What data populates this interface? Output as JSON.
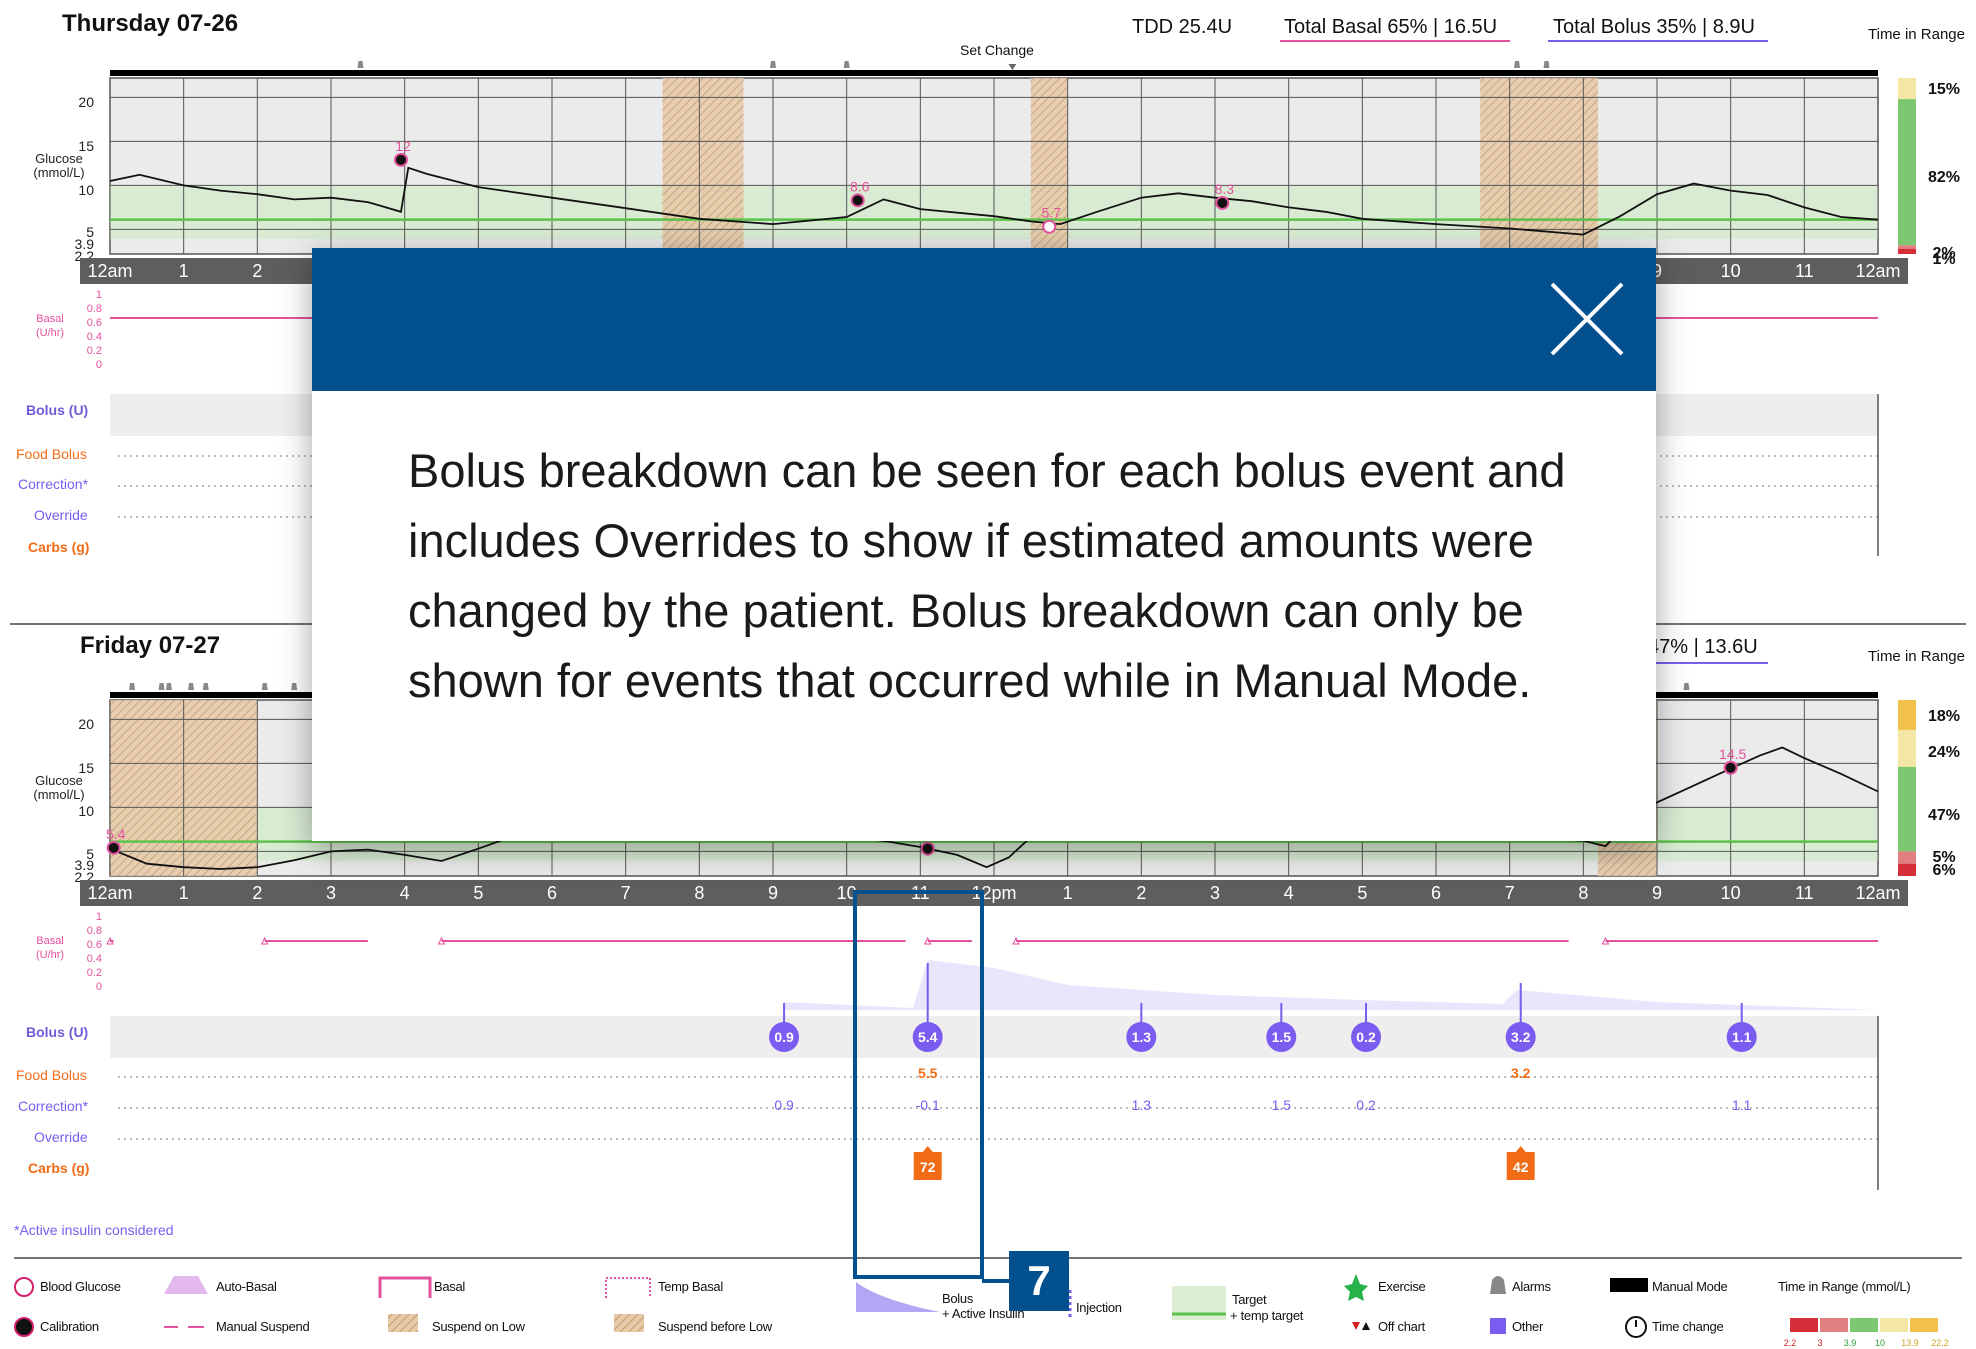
{
  "day1": {
    "title": "Thursday 07-26",
    "tdd": "TDD 25.4U",
    "total_basal": "Total Basal 65% | 16.5U",
    "total_bolus": "Total Bolus 35% | 8.9U",
    "time_in_range_label": "Time in Range",
    "tir": [
      "15%",
      "82%",
      "2%",
      "1%"
    ],
    "set_change": "Set Change",
    "glucose_markers": [
      "12",
      "8.6",
      "5.7",
      "8.3"
    ]
  },
  "day2": {
    "title": "Friday 07-27",
    "total_bolus_partial": "47% | 13.6U",
    "time_in_range_label": "Time in Range",
    "tir": [
      "18%",
      "24%",
      "47%",
      "5%",
      "6%"
    ],
    "glucose_markers": [
      "5.4",
      "14.5"
    ],
    "bolus_values": [
      "0.9",
      "5.4",
      "1.3",
      "1.5",
      "0.2",
      "3.2",
      "1.1"
    ],
    "food_bolus": [
      "5.5",
      "3.2"
    ],
    "correction": [
      "0.9",
      "-0.1",
      "1.3",
      "1.5",
      "0.2",
      "1.1"
    ],
    "carbs": [
      "72",
      "42"
    ]
  },
  "axis": {
    "glucose_label": [
      "Glucose",
      "(mmol/L)"
    ],
    "yticks": [
      "20",
      "15",
      "10",
      "5",
      "3.9",
      "2.2"
    ],
    "hours": [
      "12am",
      "1",
      "2",
      "3",
      "4",
      "5",
      "6",
      "7",
      "8",
      "9",
      "10",
      "11",
      "12pm",
      "1",
      "2",
      "3",
      "4",
      "5",
      "6",
      "7",
      "8",
      "9",
      "10",
      "11",
      "12am"
    ],
    "basal_label": [
      "Basal",
      "(U/hr)"
    ],
    "basal_ticks": [
      "1",
      "0.8",
      "0.6",
      "0.4",
      "0.2",
      "0"
    ]
  },
  "rows": {
    "bolus": "Bolus (U)",
    "food_bolus": "Food Bolus",
    "correction": "Correction*",
    "override": "Override",
    "carbs": "Carbs (g)"
  },
  "footnote": "*Active insulin considered",
  "legend": {
    "blood_glucose": "Blood Glucose",
    "calibration": "Calibration",
    "auto_basal": "Auto-Basal",
    "manual_suspend": "Manual Suspend",
    "basal": "Basal",
    "suspend_on_low": "Suspend on Low",
    "temp_basal": "Temp Basal",
    "suspend_before_low": "Suspend before Low",
    "bolus": "Bolus",
    "active_insulin": "+ Active Insulin",
    "injection": "Injection",
    "target": "Target",
    "temp_target": "+ temp target",
    "exercise": "Exercise",
    "off_chart": "Off chart",
    "alarms": "Alarms",
    "other": "Other",
    "manual_mode": "Manual Mode",
    "time_change": "Time change",
    "tir_title": "Time in Range (mmol/L)",
    "tir_ticks": [
      "2.2",
      "3",
      "3.9",
      "10",
      "13.9",
      "22.2"
    ]
  },
  "callout": {
    "number": "7"
  },
  "modal": {
    "body": "Bolus breakdown can be seen for each bolus event and includes Overrides to show if estimated amounts were changed by the patient. Bolus breakdown can only be shown for events that occurred while in Manual Mode."
  },
  "colors": {
    "modal_header": "#03508f",
    "basal_pink": "#e4529e",
    "bolus_purple": "#7a5cf0",
    "carbs_orange": "#f26c17",
    "target_green": "#5cc24a",
    "tir_green": "#7cc870",
    "tir_yellow": "#f4e7a6",
    "tir_amber": "#f1c14b",
    "tir_red": "#d62f3a"
  }
}
